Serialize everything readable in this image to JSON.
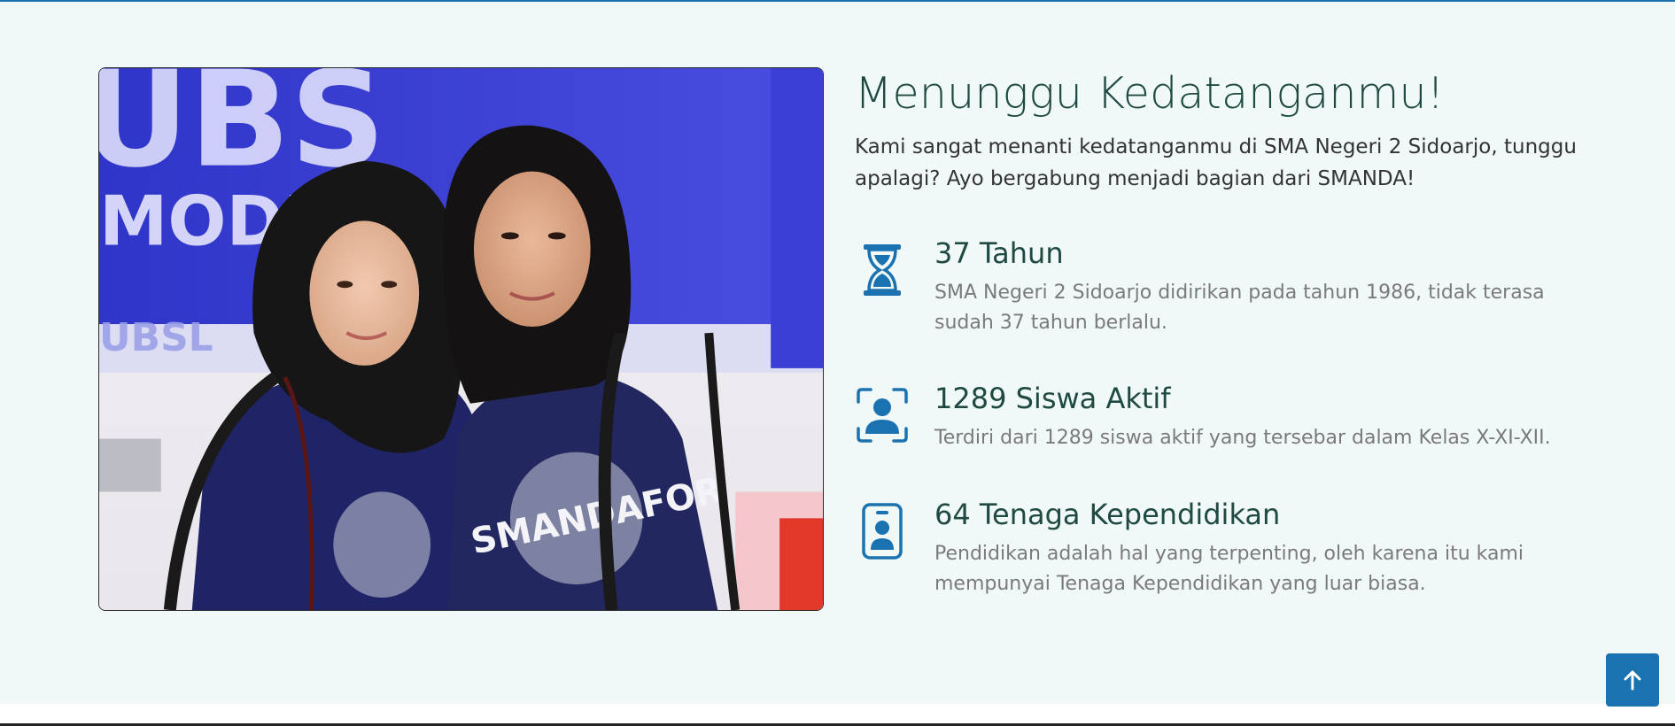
{
  "colors": {
    "accent": "#1a72b0",
    "heading": "#1e4a42",
    "background": "#f1f8f8"
  },
  "photo": {
    "alt": "Two SMANDA students smiling",
    "banner_text_1": "UBS",
    "banner_text_2": "MODE",
    "banner_text_3": "UBSL",
    "shirt_text": "SMANDAFOR"
  },
  "section": {
    "heading": "Menunggu Kedatanganmu!",
    "lead": "Kami sangat menanti kedatanganmu di SMA Negeri 2 Sidoarjo, tunggu apalagi? Ayo bergabung menjadi bagian dari SMANDA!"
  },
  "features": [
    {
      "icon": "hourglass-icon",
      "title": "37 Tahun",
      "description": "SMA Negeri 2 Sidoarjo didirikan pada tahun 1986, tidak terasa sudah 37 tahun berlalu."
    },
    {
      "icon": "person-bounding-box-icon",
      "title": "1289 Siswa Aktif",
      "description": "Terdiri dari 1289 siswa aktif yang tersebar dalam Kelas X-XI-XII."
    },
    {
      "icon": "person-badge-icon",
      "title": "64 Tenaga Kependidikan",
      "description": "Pendidikan adalah hal yang terpenting, oleh karena itu kami mempunyai Tenaga Kependidikan yang luar biasa."
    }
  ],
  "scroll_top": {
    "icon": "arrow-up-icon",
    "label": "Back to top"
  }
}
